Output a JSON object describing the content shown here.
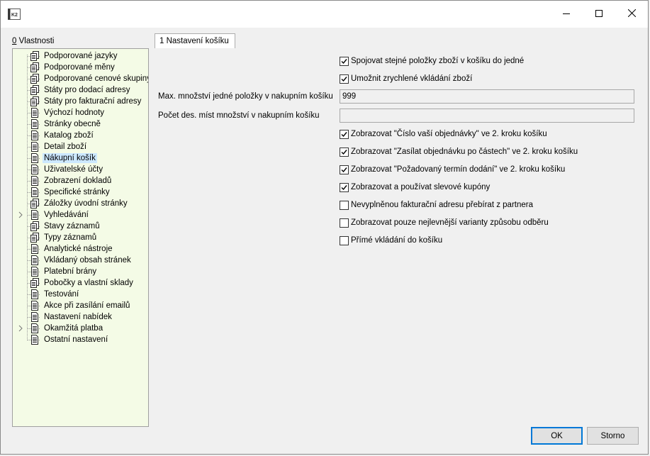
{
  "window": {
    "app_icon": "k2-logo-icon",
    "controls": [
      "minimize-icon",
      "maximize-icon",
      "close-icon"
    ]
  },
  "panel": {
    "label_accel": "0",
    "label_rest": " Vlastnosti"
  },
  "tree": {
    "selected_index": 9,
    "items": [
      {
        "label": "Podporované jazyky",
        "icon": "pages-icon",
        "expandable": false
      },
      {
        "label": "Podporované měny",
        "icon": "pages-icon",
        "expandable": false
      },
      {
        "label": "Podporované cenové skupiny",
        "icon": "pages-icon",
        "expandable": false
      },
      {
        "label": "Státy pro dodací adresy",
        "icon": "pages-icon",
        "expandable": false
      },
      {
        "label": "Státy pro fakturační adresy",
        "icon": "pages-icon",
        "expandable": false
      },
      {
        "label": "Výchozí hodnoty",
        "icon": "document-icon",
        "expandable": false
      },
      {
        "label": "Stránky obecně",
        "icon": "document-icon",
        "expandable": false
      },
      {
        "label": "Katalog zboží",
        "icon": "document-icon",
        "expandable": false
      },
      {
        "label": "Detail zboží",
        "icon": "document-icon",
        "expandable": false
      },
      {
        "label": "Nákupní košík",
        "icon": "document-icon",
        "expandable": false
      },
      {
        "label": "Uživatelské účty",
        "icon": "document-icon",
        "expandable": false
      },
      {
        "label": "Zobrazení dokladů",
        "icon": "document-icon",
        "expandable": false
      },
      {
        "label": "Specifické stránky",
        "icon": "document-icon",
        "expandable": false
      },
      {
        "label": "Záložky úvodní stránky",
        "icon": "pages-icon",
        "expandable": false
      },
      {
        "label": "Vyhledávání",
        "icon": "document-icon",
        "expandable": true
      },
      {
        "label": "Stavy záznamů",
        "icon": "pages-icon",
        "expandable": false
      },
      {
        "label": "Typy záznamů",
        "icon": "pages-icon",
        "expandable": false
      },
      {
        "label": "Analytické nástroje",
        "icon": "document-icon",
        "expandable": false
      },
      {
        "label": "Vkládaný obsah stránek",
        "icon": "document-icon",
        "expandable": false
      },
      {
        "label": "Platební brány",
        "icon": "document-icon",
        "expandable": false
      },
      {
        "label": "Pobočky a vlastní sklady",
        "icon": "pages-icon",
        "expandable": false
      },
      {
        "label": "Testování",
        "icon": "document-icon",
        "expandable": false
      },
      {
        "label": "Akce při zasílání emailů",
        "icon": "document-icon",
        "expandable": false
      },
      {
        "label": "Nastavení nabídek",
        "icon": "document-icon",
        "expandable": false
      },
      {
        "label": "Okamžitá platba",
        "icon": "document-icon",
        "expandable": true
      },
      {
        "label": "Ostatní nastavení",
        "icon": "document-icon",
        "expandable": false
      }
    ]
  },
  "tab": {
    "label": "1 Nastavení košíku"
  },
  "settings": {
    "cb_merge": {
      "label": "Spojovat stejné položky zboží v košíku do jedné",
      "checked": true
    },
    "cb_quick": {
      "label": "Umožnit zrychlené vkládání zboží",
      "checked": true
    },
    "max_qty": {
      "label": "Max. množství jedné položky v nakupním košíku",
      "value": "999"
    },
    "decimals": {
      "label": "Počet des. míst množství v nakupním košíku",
      "value": ""
    },
    "cb_order_no": {
      "label": "Zobrazovat \"Číslo vaší objednávky\" ve 2. kroku košíku",
      "checked": true
    },
    "cb_partial": {
      "label": "Zobrazovat \"Zasílat objednávku po částech\" ve 2. kroku košíku",
      "checked": true
    },
    "cb_date": {
      "label": "Zobrazovat \"Požadovaný termín dodání\" ve 2. kroku košíku",
      "checked": true
    },
    "cb_coupons": {
      "label": "Zobrazovat a používat slevové kupóny",
      "checked": true
    },
    "cb_invoice_addr": {
      "label": "Nevyplněnou fakturační adresu přebírat z partnera",
      "checked": false
    },
    "cb_cheapest": {
      "label": "Zobrazovat pouze nejlevnější varianty způsobu odběru",
      "checked": false
    },
    "cb_direct": {
      "label": "Přímé vkládání do košíku",
      "checked": false
    }
  },
  "buttons": {
    "ok": "OK",
    "cancel": "Storno"
  }
}
